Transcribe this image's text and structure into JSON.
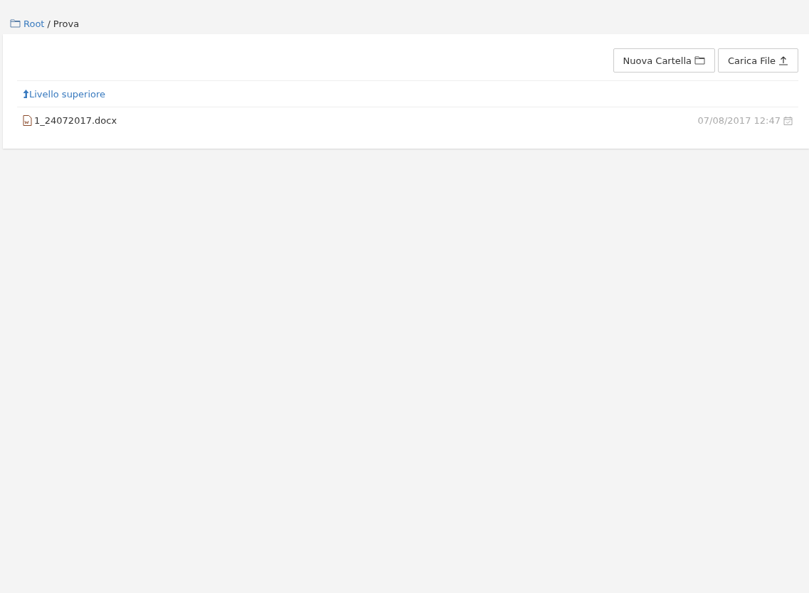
{
  "breadcrumb": {
    "separator": "/",
    "items": [
      {
        "label": "Root",
        "kind": "link"
      },
      {
        "label": "Prova",
        "kind": "current"
      }
    ]
  },
  "toolbar": {
    "buttons": [
      {
        "label": "Nuova Cartella",
        "kind": "folder"
      },
      {
        "label": "Carica File",
        "kind": "upload"
      }
    ]
  },
  "up_link": {
    "label": "Livello superiore"
  },
  "files": [
    {
      "name": "1_24072017.docx",
      "date": "07/08/2017 12:47"
    }
  ]
}
